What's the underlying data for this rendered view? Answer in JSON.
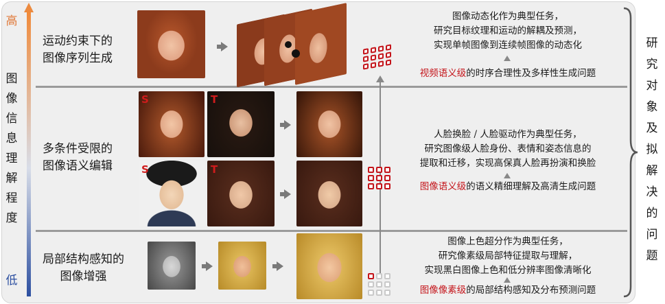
{
  "axis": {
    "high": "高",
    "low": "低",
    "label_chars": [
      "图",
      "像",
      "信",
      "息",
      "理",
      "解",
      "程",
      "度"
    ],
    "colors": {
      "high": "#e07a3a",
      "low": "#2c4fa0"
    }
  },
  "rows": [
    {
      "title_lines": [
        "运动约束下的",
        "图像序列生成"
      ],
      "task_lines": [
        "图像动态化作为典型任务，",
        "研究目标纹理和运动的解耦及预测，",
        "实现单帧图像到连续帧图像的动态化"
      ],
      "problem_highlight": "视频语义级",
      "problem_rest": "的时序合理性及多样性生成问题"
    },
    {
      "title_lines": [
        "多条件受限的",
        "图像语义编辑"
      ],
      "task_lines": [
        "人脸换脸 / 人脸驱动作为典型任务，",
        "研究图像级人脸身份、表情和姿态信息的",
        "提取和迁移，实现高保真人脸再扮演和换脸"
      ],
      "problem_highlight": "图像语义级",
      "problem_rest": "的语义精细理解及高清生成问题",
      "source_label": "S",
      "target_label": "T"
    },
    {
      "title_lines": [
        "局部结构感知的",
        "图像增强"
      ],
      "task_lines": [
        "图像上色超分作为典型任务，",
        "研究像素级局部特征提取与理解，",
        "实现黑白图像上色和低分辨率图像清晰化"
      ],
      "problem_highlight": "图像像素级",
      "problem_rest": "的局部结构感知及分布预测问题"
    }
  ],
  "right_label_chars": [
    "研",
    "究",
    "对",
    "象",
    "及",
    "拟",
    "解",
    "决",
    "的",
    "问",
    "题"
  ],
  "icons": [
    "arrow-right-icon",
    "up-arrow-icon",
    "brace-icon",
    "pixel-grid-icon"
  ]
}
